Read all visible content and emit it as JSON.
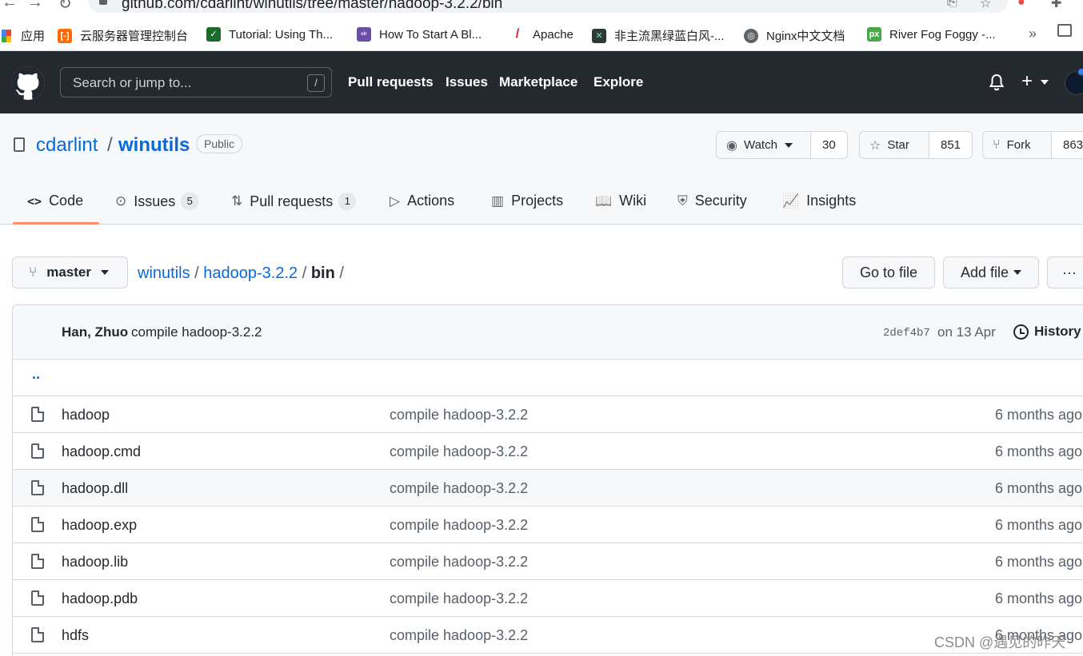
{
  "browser": {
    "url": "github.com/cdarlint/winutils/tree/master/hadoop-3.2.2/bin",
    "bookmarks": [
      {
        "label": "应用",
        "icon": "apps-grid-icon"
      },
      {
        "label": "云服务器管理控制台",
        "icon": "aliyun-icon"
      },
      {
        "label": "Tutorial: Using Th...",
        "icon": "leaf-icon"
      },
      {
        "label": "How To Start A Bl...",
        "icon": "colorlib-icon"
      },
      {
        "label": "Apache",
        "icon": "apache-feather-icon"
      },
      {
        "label": "非主流黑绿蓝白风-...",
        "icon": "cross-grid-icon"
      },
      {
        "label": "Nginx中文文档",
        "icon": "globe-icon"
      },
      {
        "label": "River Fog Foggy -...",
        "icon": "pixabay-icon"
      }
    ],
    "bookmarks_more": "»"
  },
  "header": {
    "search_placeholder": "Search or jump to...",
    "search_shortcut": "/",
    "nav": [
      "Pull requests",
      "Issues",
      "Marketplace",
      "Explore"
    ],
    "plus": "+"
  },
  "repo": {
    "owner": "cdarlint",
    "separator": "/",
    "name": "winutils",
    "visibility": "Public",
    "watch": {
      "label": "Watch",
      "count": "30"
    },
    "star": {
      "label": "Star",
      "count": "851"
    },
    "fork": {
      "label": "Fork",
      "count": "863"
    }
  },
  "tabs": [
    {
      "label": "Code",
      "icon": "<>"
    },
    {
      "label": "Issues",
      "count": "5",
      "icon": "⊙"
    },
    {
      "label": "Pull requests",
      "count": "1",
      "icon": "⇅"
    },
    {
      "label": "Actions",
      "icon": "▷"
    },
    {
      "label": "Projects",
      "icon": "▥"
    },
    {
      "label": "Wiki",
      "icon": "📖"
    },
    {
      "label": "Security",
      "icon": "⛨"
    },
    {
      "label": "Insights",
      "icon": "📈"
    }
  ],
  "filenav": {
    "branch": "master",
    "crumbs": [
      "winutils",
      "hadoop-3.2.2",
      "bin"
    ],
    "sep": "/",
    "go_to_file": "Go to file",
    "add_file": "Add file",
    "more": "···"
  },
  "commit": {
    "author": "Han, Zhuo",
    "message": "compile hadoop-3.2.2",
    "sha": "2def4b7",
    "date": "on 13 Apr",
    "history": "History"
  },
  "parent_dir": "..",
  "files": [
    {
      "name": "hadoop",
      "message": "compile hadoop-3.2.2",
      "age": "6 months ago"
    },
    {
      "name": "hadoop.cmd",
      "message": "compile hadoop-3.2.2",
      "age": "6 months ago"
    },
    {
      "name": "hadoop.dll",
      "message": "compile hadoop-3.2.2",
      "age": "6 months ago"
    },
    {
      "name": "hadoop.exp",
      "message": "compile hadoop-3.2.2",
      "age": "6 months ago"
    },
    {
      "name": "hadoop.lib",
      "message": "compile hadoop-3.2.2",
      "age": "6 months ago"
    },
    {
      "name": "hadoop.pdb",
      "message": "compile hadoop-3.2.2",
      "age": "6 months ago"
    },
    {
      "name": "hdfs",
      "message": "compile hadoop-3.2.2",
      "age": "6 months ago"
    }
  ],
  "watermark": "CSDN @遇见的昨天"
}
